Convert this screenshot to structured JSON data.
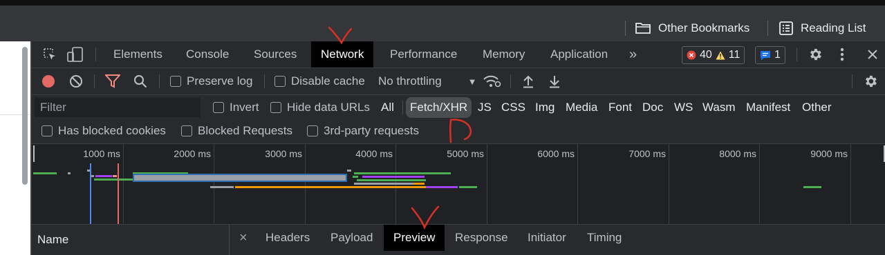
{
  "bookmarks": {
    "other_bookmarks": "Other Bookmarks",
    "reading_list": "Reading List"
  },
  "devtools": {
    "tabs": [
      "Elements",
      "Console",
      "Sources",
      "Network",
      "Performance",
      "Memory",
      "Application"
    ],
    "more_tabs": "»",
    "errors_count": "40",
    "warnings_count": "11",
    "issues_count": "1",
    "active_tab": "Network"
  },
  "network_toolbar": {
    "preserve_log": "Preserve log",
    "disable_cache": "Disable cache",
    "throttling": "No throttling",
    "throttling_arrow": "▼"
  },
  "filter_bar": {
    "filter_placeholder": "Filter",
    "invert": "Invert",
    "hide_data_urls": "Hide data URLs",
    "types": [
      "All",
      "Fetch/XHR",
      "JS",
      "CSS",
      "Img",
      "Media",
      "Font",
      "Doc",
      "WS",
      "Wasm",
      "Manifest",
      "Other"
    ],
    "active_type": "Fetch/XHR",
    "has_blocked_cookies": "Has blocked cookies",
    "blocked_requests": "Blocked Requests",
    "third_party": "3rd-party requests"
  },
  "overview": {
    "ticks": [
      "1000 ms",
      "2000 ms",
      "3000 ms",
      "4000 ms",
      "5000 ms",
      "6000 ms",
      "7000 ms",
      "8000 ms",
      "9000 ms"
    ]
  },
  "detail": {
    "name_header": "Name",
    "close": "×",
    "tabs": [
      "Headers",
      "Payload",
      "Preview",
      "Response",
      "Initiator",
      "Timing"
    ],
    "active_tab": "Preview"
  },
  "colors": {
    "active_tab_bg": "#000000",
    "record_red": "#e46962",
    "filter_red": "#f28b82",
    "error_red": "#e8453c",
    "warning_yellow": "#fdd663",
    "issue_blue": "#1a73e8",
    "annotation_red": "#d93025"
  }
}
